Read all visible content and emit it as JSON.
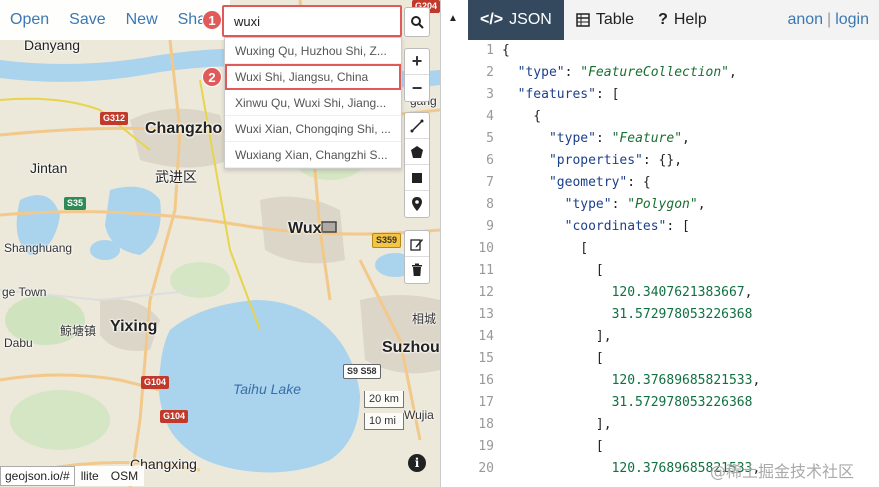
{
  "menu": {
    "open": "Open",
    "save": "Save",
    "new": "New",
    "share": "Sha"
  },
  "search": {
    "value": "wuxi",
    "results": [
      "Wuxing Qu, Huzhou Shi, Z...",
      "Wuxi Shi, Jiangsu, China",
      "Xinwu Qu, Wuxi Shi, Jiang...",
      "Wuxi Xian, Chongqing Shi, ...",
      "Wuxiang Xian, Changzhi S..."
    ]
  },
  "badges": {
    "one": "1",
    "two": "2"
  },
  "tools": {
    "zoom_in": "+",
    "zoom_out": "−"
  },
  "map": {
    "labels": {
      "danyang": "Danyang",
      "changzhou": "Changzho",
      "jintan": "Jintan",
      "wujin": "武进区",
      "shanghuang": "Shanghuang",
      "gehu": "ge Town",
      "jingzhen": "鲸塘镇",
      "yixing": "Yixing",
      "dabu": "Dabu",
      "changxing": "Changxing",
      "wuxi": "Wux",
      "xiangcheng": "相城",
      "suzhou": "Suzhou",
      "wujia": "Wujia",
      "gang": "gang",
      "lake": "Taihu Lake"
    },
    "shields": {
      "g312": "G312",
      "s35": "S35",
      "s359": "S359",
      "s9s58": "S9 S58",
      "g104a": "G104",
      "g104b": "G104",
      "g204": "G204"
    },
    "scale_km": "20 km",
    "scale_mi": "10 mi"
  },
  "status_url": "geojson.io/#",
  "layers": {
    "satellite": "llite",
    "osm": "OSM"
  },
  "tabs": {
    "json": "JSON",
    "table": "Table",
    "help": "Help"
  },
  "auth": {
    "anon": "anon",
    "sep": "|",
    "login": "login"
  },
  "code_lines": [
    "{",
    "  \"type\": \"FeatureCollection\",",
    "  \"features\": [",
    "    {",
    "      \"type\": \"Feature\",",
    "      \"properties\": {},",
    "      \"geometry\": {",
    "        \"type\": \"Polygon\",",
    "        \"coordinates\": [",
    "          [",
    "            [",
    "              120.3407621383667,",
    "              31.572978053226368",
    "            ],",
    "            [",
    "              120.37689685821533,",
    "              31.572978053226368",
    "            ],",
    "            [",
    "              120.37689685821533,"
  ],
  "watermark": "@稀土掘金技术社区"
}
